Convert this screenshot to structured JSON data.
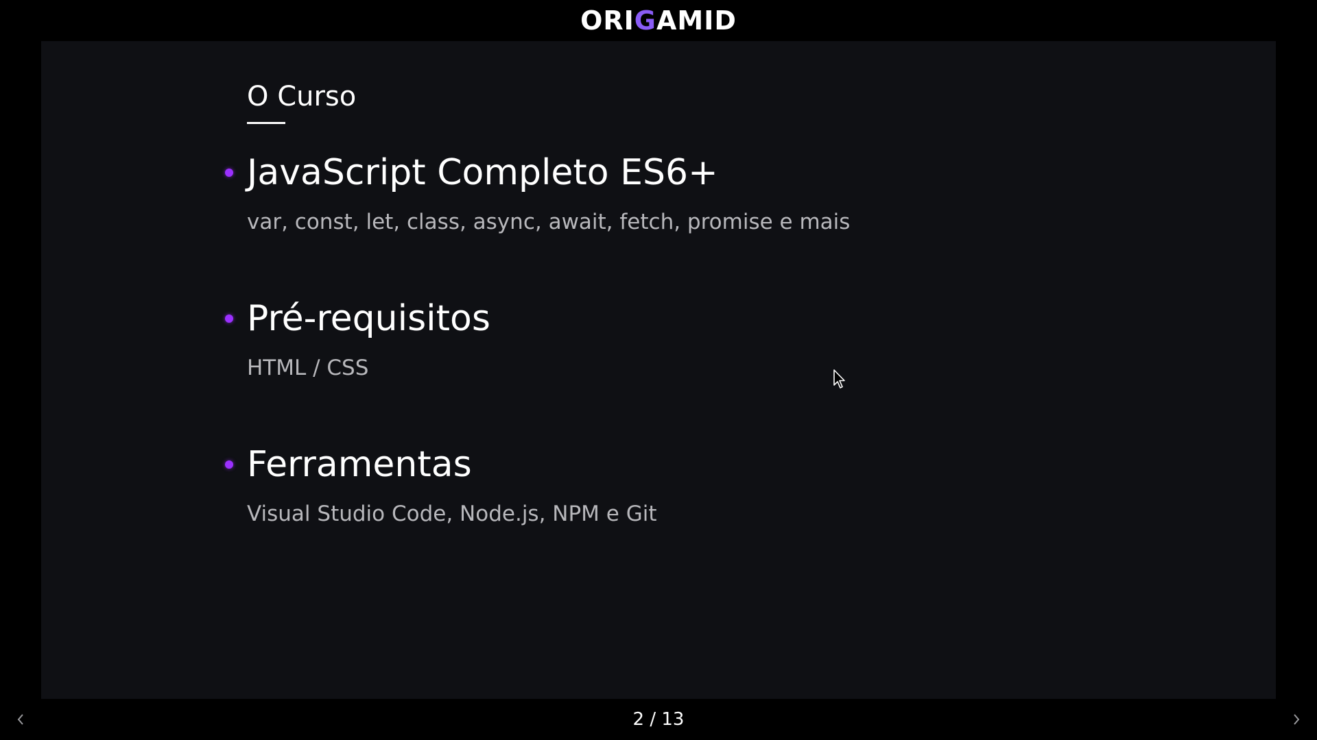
{
  "header": {
    "logo_prefix": "ORI",
    "logo_accent": "G",
    "logo_suffix": "AMID"
  },
  "slide": {
    "title": "O Curso",
    "items": [
      {
        "heading": "JavaScript Completo ES6+",
        "description": "var, const, let, class, async, await, fetch, promise e mais"
      },
      {
        "heading": "Pré-requisitos",
        "description": "HTML / CSS"
      },
      {
        "heading": "Ferramentas",
        "description": "Visual Studio Code, Node.js, NPM e Git"
      }
    ]
  },
  "footer": {
    "counter": "2 / 13",
    "prev_icon": "chevron-left-icon",
    "next_icon": "chevron-right-icon"
  },
  "colors": {
    "background": "#000000",
    "slide_background": "#0f1014",
    "bullet": "#9b30ff",
    "logo_accent": "#8a5cf6",
    "text_primary": "#ffffff",
    "text_secondary": "#b8b8bc"
  }
}
